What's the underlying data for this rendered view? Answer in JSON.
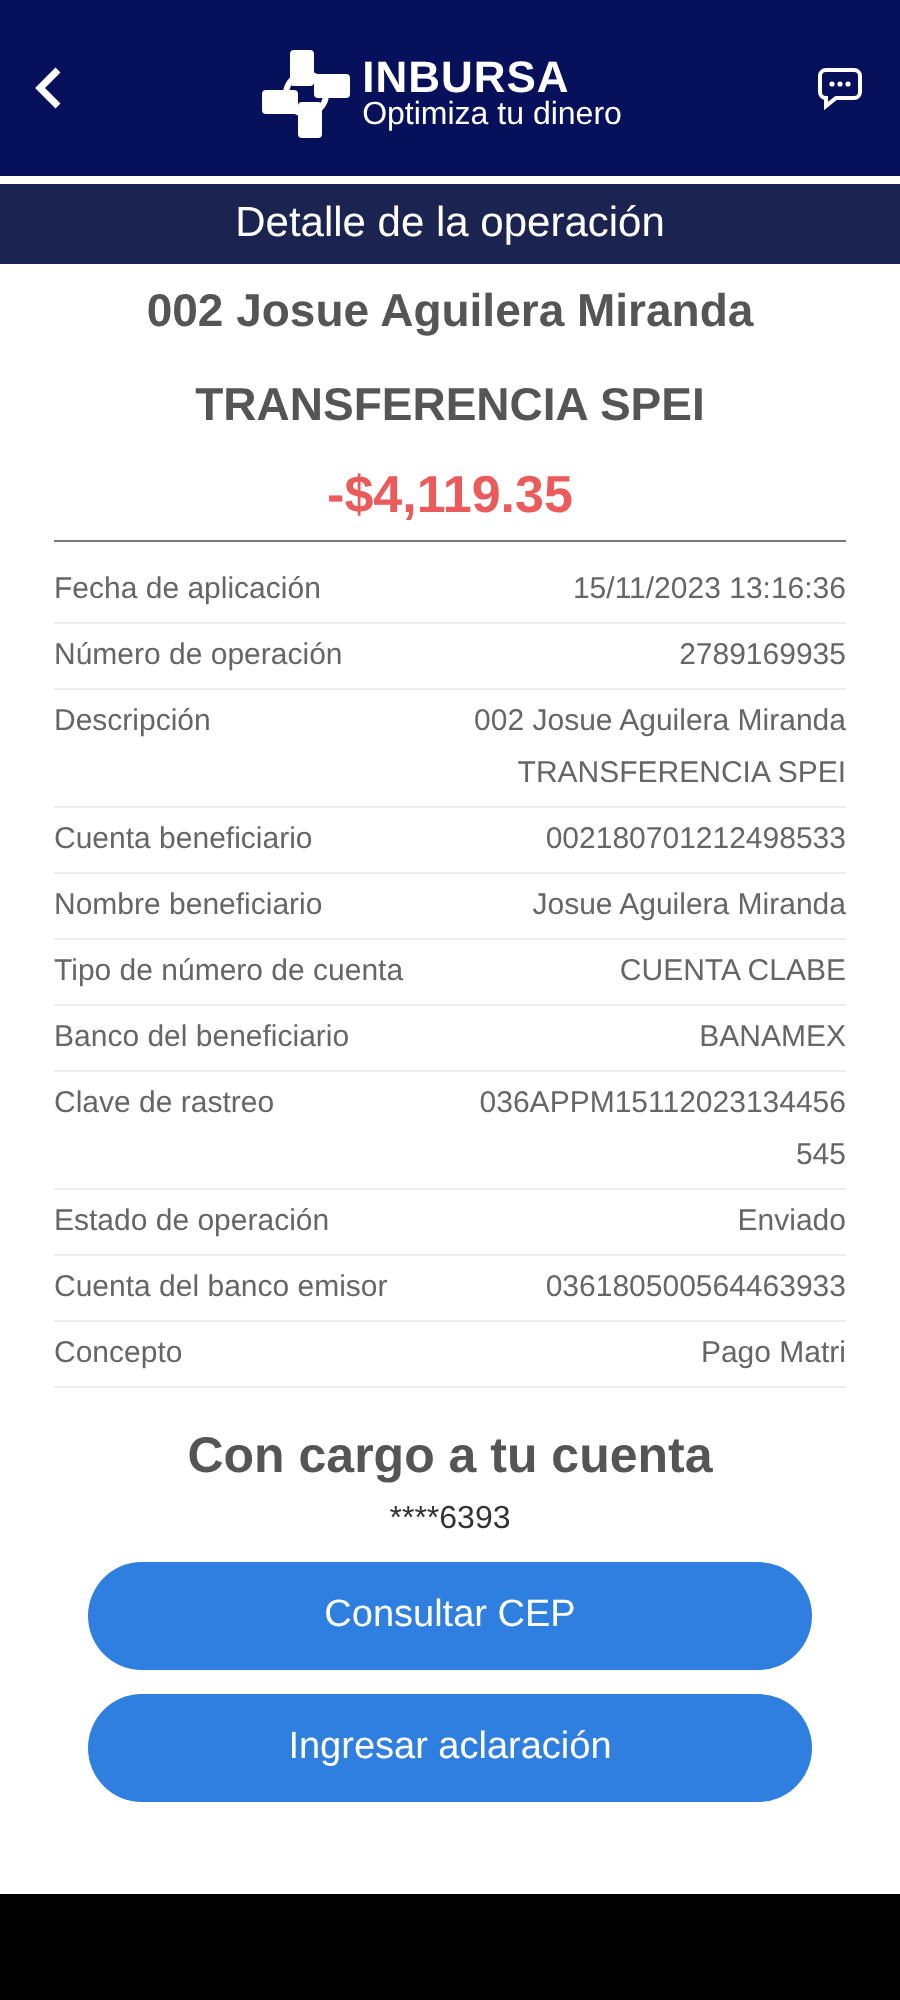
{
  "header": {
    "brand": "INBURSA",
    "tagline": "Optimiza tu dinero"
  },
  "subheader": {
    "title": "Detalle de la operación"
  },
  "summary": {
    "lines": [
      "002 Josue Aguilera Miranda",
      "TRANSFERENCIA SPEI"
    ],
    "amount": "-$4,119.35"
  },
  "details": [
    {
      "label": "Fecha de aplicación",
      "value_lines": [
        "15/11/2023 13:16:36"
      ]
    },
    {
      "label": "Número de operación",
      "value_lines": [
        "2789169935"
      ]
    },
    {
      "label": "Descripción",
      "value_lines": [
        "002 Josue Aguilera Miranda",
        "TRANSFERENCIA SPEI"
      ]
    },
    {
      "label": "Cuenta beneficiario",
      "value_lines": [
        "002180701212498533"
      ]
    },
    {
      "label": "Nombre beneficiario",
      "value_lines": [
        "Josue Aguilera Miranda"
      ]
    },
    {
      "label": "Tipo de número de cuenta",
      "value_lines": [
        "CUENTA CLABE"
      ]
    },
    {
      "label": "Banco del beneficiario",
      "value_lines": [
        "BANAMEX"
      ]
    },
    {
      "label": "Clave de rastreo",
      "value_lines": [
        "036APPM15112023134456",
        "545"
      ]
    },
    {
      "label": "Estado de operación",
      "value_lines": [
        "Enviado"
      ]
    },
    {
      "label": "Cuenta del banco emisor",
      "value_lines": [
        "036180500564463933"
      ]
    },
    {
      "label": "Concepto",
      "value_lines": [
        "Pago Matri"
      ]
    }
  ],
  "charge": {
    "title": "Con cargo a tu cuenta",
    "account": "****6393"
  },
  "buttons": [
    "Consultar CEP",
    "Ingresar aclaración"
  ]
}
